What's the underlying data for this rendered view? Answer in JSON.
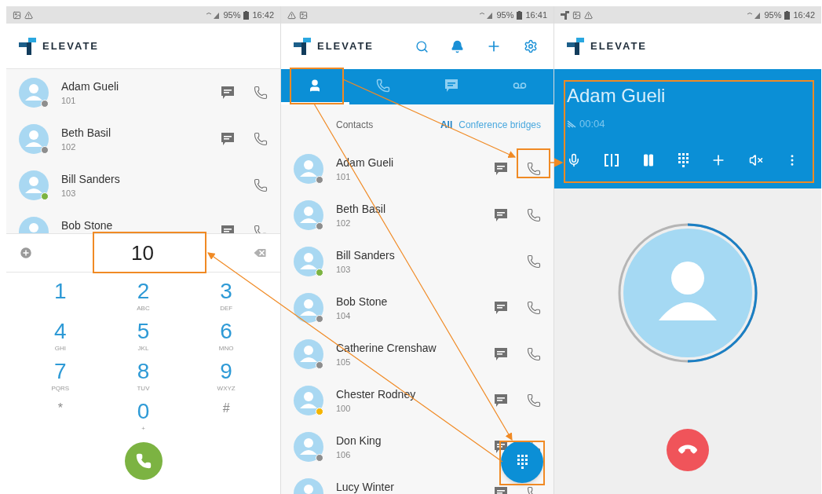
{
  "dialer_screen": {
    "status_bar": {
      "battery": "95%",
      "time": "16:42"
    },
    "logo": "ELEVATE",
    "contacts": [
      {
        "name": "Adam Gueli",
        "ext": "101",
        "color": "#8e8e8e",
        "message": true
      },
      {
        "name": "Beth Basil",
        "ext": "102",
        "color": "#8e8e8e",
        "message": true
      },
      {
        "name": "Bill Sanders",
        "ext": "103",
        "color": "#7cb342",
        "message": false
      },
      {
        "name": "Bob Stone",
        "message": true
      }
    ],
    "number": "10",
    "keys": [
      {
        "kind": "digit",
        "label": "1"
      },
      {
        "kind": "digit",
        "label": "2",
        "letters": "ABC"
      },
      {
        "kind": "digit",
        "label": "3",
        "letters": "DEF"
      },
      {
        "kind": "digit",
        "label": "4",
        "letters": "GHI"
      },
      {
        "kind": "digit",
        "label": "5",
        "letters": "JKL"
      },
      {
        "kind": "digit",
        "label": "6",
        "letters": "MNO"
      },
      {
        "kind": "digit",
        "label": "7",
        "letters": "PQRS"
      },
      {
        "kind": "digit",
        "label": "8",
        "letters": "TUV"
      },
      {
        "kind": "digit",
        "label": "9",
        "letters": "WXYZ"
      },
      {
        "kind": "symbol",
        "label": "*"
      },
      {
        "kind": "digit",
        "label": "0",
        "letters": "+"
      },
      {
        "kind": "symbol",
        "label": "#"
      }
    ]
  },
  "contacts_screen": {
    "status_bar": {
      "battery": "95%",
      "time": "16:41"
    },
    "logo": "ELEVATE",
    "tabs": [
      {
        "kind": "contacts",
        "selected": true
      },
      {
        "kind": "calls",
        "selected": false
      },
      {
        "kind": "messages",
        "selected": false
      },
      {
        "kind": "voicemail",
        "selected": false
      }
    ],
    "list_title": "Contacts",
    "filters": [
      {
        "label": "All",
        "selected": true
      },
      {
        "label": "Conference bridges",
        "selected": false
      }
    ],
    "contacts": [
      {
        "name": "Adam Gueli",
        "ext": "101",
        "color": "#8e8e8e",
        "message": true
      },
      {
        "name": "Beth Basil",
        "ext": "102",
        "color": "#8e8e8e",
        "message": true
      },
      {
        "name": "Bill Sanders",
        "ext": "103",
        "color": "#7cb342",
        "message": false
      },
      {
        "name": "Bob Stone",
        "ext": "104",
        "color": "#8e8e8e",
        "message": true
      },
      {
        "name": "Catherine Crenshaw",
        "ext": "105",
        "color": "#8e8e8e",
        "message": true
      },
      {
        "name": "Chester Rodney",
        "ext": "100",
        "color": "#f4b400",
        "message": true
      },
      {
        "name": "Don King",
        "ext": "106",
        "color": "#8e8e8e",
        "message": true
      },
      {
        "name": "Lucy Winter",
        "message": true
      }
    ]
  },
  "call_screen": {
    "status_bar": {
      "battery": "95%",
      "time": "16:42"
    },
    "logo": "ELEVATE",
    "caller": "Adam Gueli",
    "duration": "00:04",
    "controls": [
      {
        "kind": "mic"
      },
      {
        "kind": "transfer"
      },
      {
        "kind": "hold"
      },
      {
        "kind": "keypad"
      },
      {
        "kind": "add"
      },
      {
        "kind": "speaker_off"
      },
      {
        "kind": "more"
      }
    ]
  }
}
